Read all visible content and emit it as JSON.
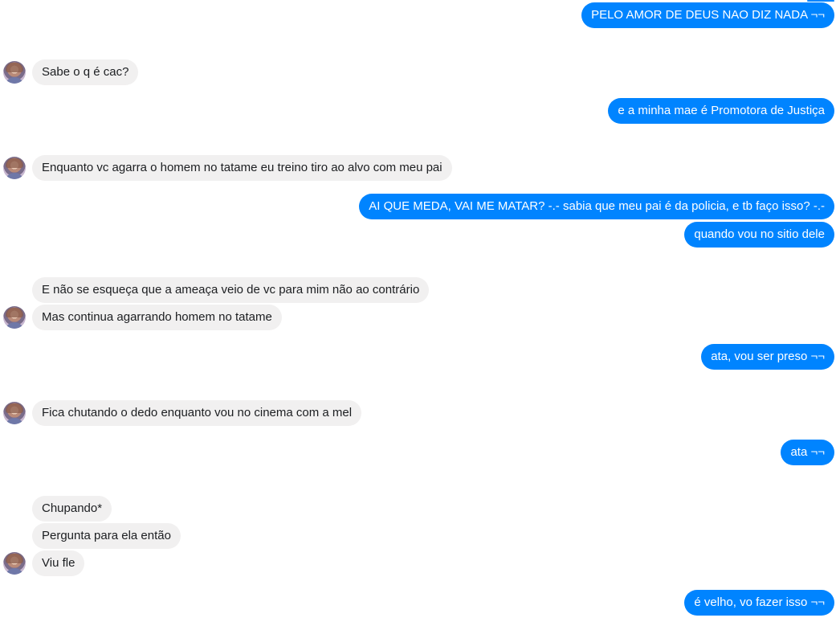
{
  "messages": [
    {
      "from": "me",
      "text": "PELO AMOR DE DEUS NAO DIZ NADA ¬¬"
    },
    {
      "from": "them",
      "text": "Sabe o q é cac?"
    },
    {
      "from": "me",
      "text": "e a minha mae é Promotora de Justiça"
    },
    {
      "from": "them",
      "text": "Enquanto vc agarra o homem no tatame eu treino tiro ao alvo com meu pai"
    },
    {
      "from": "me",
      "text": "AI QUE MEDA, VAI ME MATAR? -.- sabia que meu pai é da policia, e tb faço isso? -.-"
    },
    {
      "from": "me",
      "text": "quando vou no sitio dele"
    },
    {
      "from": "them",
      "text": "E não se esqueça que a ameaça veio de vc para  mim não ao contrário"
    },
    {
      "from": "them",
      "text": "Mas continua agarrando homem no tatame"
    },
    {
      "from": "me",
      "text": "ata, vou ser preso ¬¬"
    },
    {
      "from": "them",
      "text": "Fica chutando o dedo enquanto vou no cinema com a mel"
    },
    {
      "from": "me",
      "text": "ata ¬¬"
    },
    {
      "from": "them",
      "text": "Chupando*"
    },
    {
      "from": "them",
      "text": "Pergunta para  ela então"
    },
    {
      "from": "them",
      "text": "Viu fle"
    },
    {
      "from": "me",
      "text": "é velho, vo fazer isso ¬¬"
    }
  ],
  "colors": {
    "sent_bubble": "#0084ff",
    "received_bubble": "#f1f0f0",
    "sent_text": "#ffffff",
    "received_text": "#1c1e21"
  },
  "icons": {
    "contact_avatar": "contact-avatar-icon"
  }
}
